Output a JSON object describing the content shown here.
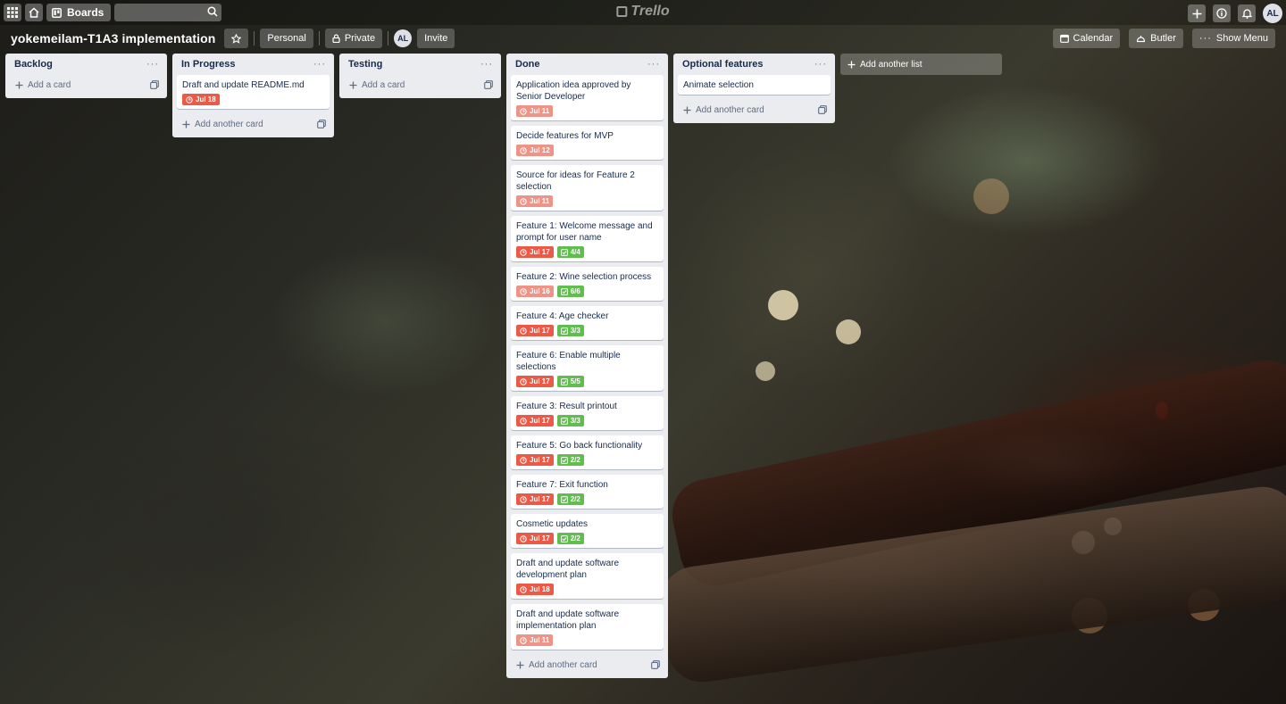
{
  "header": {
    "apps_icon": "grid-icon",
    "home_icon": "home-icon",
    "boards_label": "Boards",
    "search_value": "",
    "logo_text": "Trello",
    "avatar_initials": "AL"
  },
  "board": {
    "title": "yokemeilam-T1A3 implementation",
    "team_label": "Personal",
    "visibility_label": "Private",
    "member_initials": "AL",
    "invite_label": "Invite",
    "calendar_label": "Calendar",
    "butler_label": "Butler",
    "menu_label": "Show Menu"
  },
  "lists": [
    {
      "title": "Backlog",
      "cards": [],
      "add_label": "Add a card"
    },
    {
      "title": "In Progress",
      "cards": [
        {
          "title": "Draft and update README.md",
          "due": "Jul 18",
          "due_style": "red"
        }
      ],
      "add_label": "Add another card"
    },
    {
      "title": "Testing",
      "cards": [],
      "add_label": "Add a card"
    },
    {
      "title": "Done",
      "cards": [
        {
          "title": "Application idea approved by Senior Developer",
          "due": "Jul 11",
          "due_style": "pale"
        },
        {
          "title": "Decide features for MVP",
          "due": "Jul 12",
          "due_style": "pale"
        },
        {
          "title": "Source for ideas for Feature 2 selection",
          "due": "Jul 11",
          "due_style": "pale"
        },
        {
          "title": "Feature 1: Welcome message and prompt for user name",
          "due": "Jul 17",
          "due_style": "red",
          "checklist": "4/4"
        },
        {
          "title": "Feature 2: Wine selection process",
          "due": "Jul 16",
          "due_style": "pale",
          "checklist": "6/6"
        },
        {
          "title": "Feature 4: Age checker",
          "due": "Jul 17",
          "due_style": "red",
          "checklist": "3/3"
        },
        {
          "title": "Feature 6: Enable multiple selections",
          "due": "Jul 17",
          "due_style": "red",
          "checklist": "5/5"
        },
        {
          "title": "Feature 3: Result printout",
          "due": "Jul 17",
          "due_style": "red",
          "checklist": "3/3"
        },
        {
          "title": "Feature 5: Go back functionality",
          "due": "Jul 17",
          "due_style": "red",
          "checklist": "2/2"
        },
        {
          "title": "Feature 7: Exit function",
          "due": "Jul 17",
          "due_style": "red",
          "checklist": "2/2"
        },
        {
          "title": "Cosmetic updates",
          "due": "Jul 17",
          "due_style": "red",
          "checklist": "2/2"
        },
        {
          "title": "Draft and update software development plan",
          "due": "Jul 18",
          "due_style": "red"
        },
        {
          "title": "Draft and update software implementation plan",
          "due": "Jul 11",
          "due_style": "pale"
        }
      ],
      "add_label": "Add another card"
    },
    {
      "title": "Optional features",
      "cards": [
        {
          "title": "Animate selection"
        }
      ],
      "add_label": "Add another card"
    }
  ],
  "add_list_label": "Add another list",
  "colors": {
    "due_red": "#eb5a46",
    "due_pale": "#ec9488",
    "checklist_green": "#61bd4f",
    "list_bg": "#ebecf0"
  }
}
